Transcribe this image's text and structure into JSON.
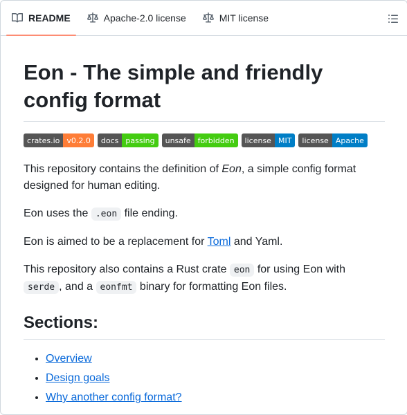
{
  "tabs": [
    {
      "label": "README",
      "icon": "book-icon",
      "active": true
    },
    {
      "label": "Apache-2.0 license",
      "icon": "scale-icon"
    },
    {
      "label": "MIT license",
      "icon": "scale-icon"
    }
  ],
  "toc_icon": "list-icon",
  "title": "Eon - The simple and friendly config format",
  "badges": [
    {
      "left": "crates.io",
      "right": "v0.2.0",
      "color": "#fe7d37"
    },
    {
      "left": "docs",
      "right": "passing",
      "color": "#4c1"
    },
    {
      "left": "unsafe",
      "right": "forbidden",
      "color": "#4c1"
    },
    {
      "left": "license",
      "right": "MIT",
      "color": "#007ec6"
    },
    {
      "left": "license",
      "right": "Apache",
      "color": "#007ec6"
    }
  ],
  "paragraphs": {
    "p1_before": "This repository contains the definition of ",
    "p1_em": "Eon",
    "p1_after": ", a simple config format designed for human editing.",
    "p2_before": "Eon uses the ",
    "p2_code": ".eon",
    "p2_after": " file ending.",
    "p3_before": "Eon is aimed to be a replacement for ",
    "p3_link": "Toml",
    "p3_after": " and Yaml.",
    "p4_before": "This repository also contains a Rust crate ",
    "p4_code1": "eon",
    "p4_mid1": " for using Eon with ",
    "p4_code2": "serde",
    "p4_mid2": ", and a ",
    "p4_code3": "eonfmt",
    "p4_after": " binary for formatting Eon files."
  },
  "sections_heading": "Sections:",
  "sections": [
    "Overview",
    "Design goals",
    "Why another config format?"
  ]
}
